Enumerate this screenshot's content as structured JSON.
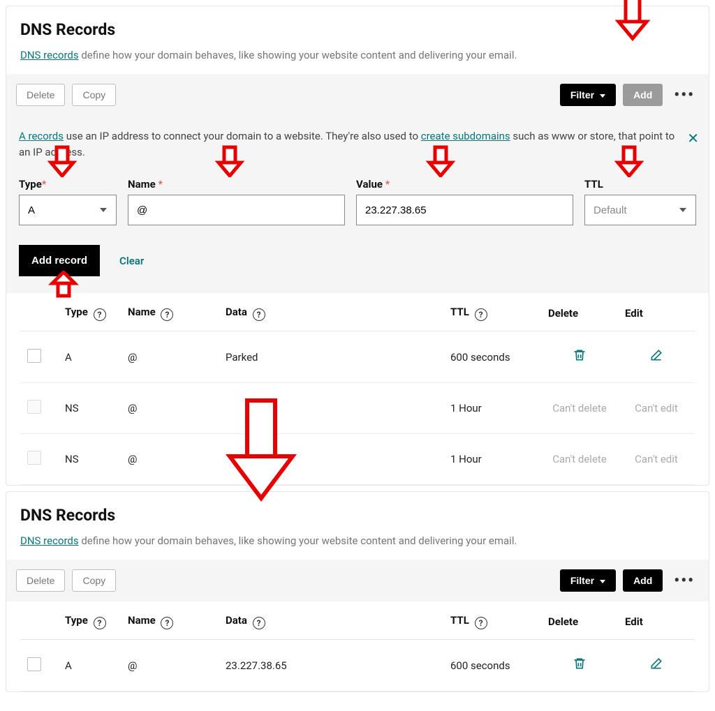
{
  "section1": {
    "title": "DNS Records",
    "link_label": "DNS records",
    "subtitle_rest": " define how your domain behaves, like showing your website content and delivering your email.",
    "toolbar": {
      "delete": "Delete",
      "copy": "Copy",
      "filter": "Filter",
      "add": "Add",
      "more": "•••"
    },
    "info": {
      "a_records_link": "A records",
      "text_part1": " use an IP address to connect your domain to a website. They're also used to ",
      "create_sub_link": "create subdomains",
      "text_part2": " such as www or store, that point to an IP address."
    },
    "form": {
      "type_label": "Type",
      "name_label": "Name ",
      "value_label": "Value ",
      "ttl_label": "TTL",
      "type_value": "A",
      "name_value": "@",
      "value_value": "23.227.38.65",
      "ttl_value": "Default",
      "add_record": "Add record",
      "clear": "Clear"
    },
    "table": {
      "headers": {
        "type": "Type",
        "name": "Name",
        "data": "Data",
        "ttl": "TTL",
        "delete": "Delete",
        "edit": "Edit"
      },
      "rows": [
        {
          "type": "A",
          "name": "@",
          "data": "Parked",
          "ttl": "600 seconds",
          "deletable": true,
          "editable": true
        },
        {
          "type": "NS",
          "name": "@",
          "data": "",
          "ttl": "1 Hour",
          "deletable": false,
          "editable": false,
          "cant_delete": "Can't delete",
          "cant_edit": "Can't edit"
        },
        {
          "type": "NS",
          "name": "@",
          "data": "",
          "ttl": "1 Hour",
          "deletable": false,
          "editable": false,
          "cant_delete": "Can't delete",
          "cant_edit": "Can't edit"
        }
      ]
    }
  },
  "section2": {
    "title": "DNS Records",
    "link_label": "DNS records",
    "subtitle_rest": " define how your domain behaves, like showing your website content and delivering your email.",
    "toolbar": {
      "delete": "Delete",
      "copy": "Copy",
      "filter": "Filter",
      "add": "Add",
      "more": "•••"
    },
    "table": {
      "headers": {
        "type": "Type",
        "name": "Name",
        "data": "Data",
        "ttl": "TTL",
        "delete": "Delete",
        "edit": "Edit"
      },
      "rows": [
        {
          "type": "A",
          "name": "@",
          "data": "23.227.38.65",
          "ttl": "600 seconds",
          "deletable": true,
          "editable": true
        }
      ]
    }
  }
}
